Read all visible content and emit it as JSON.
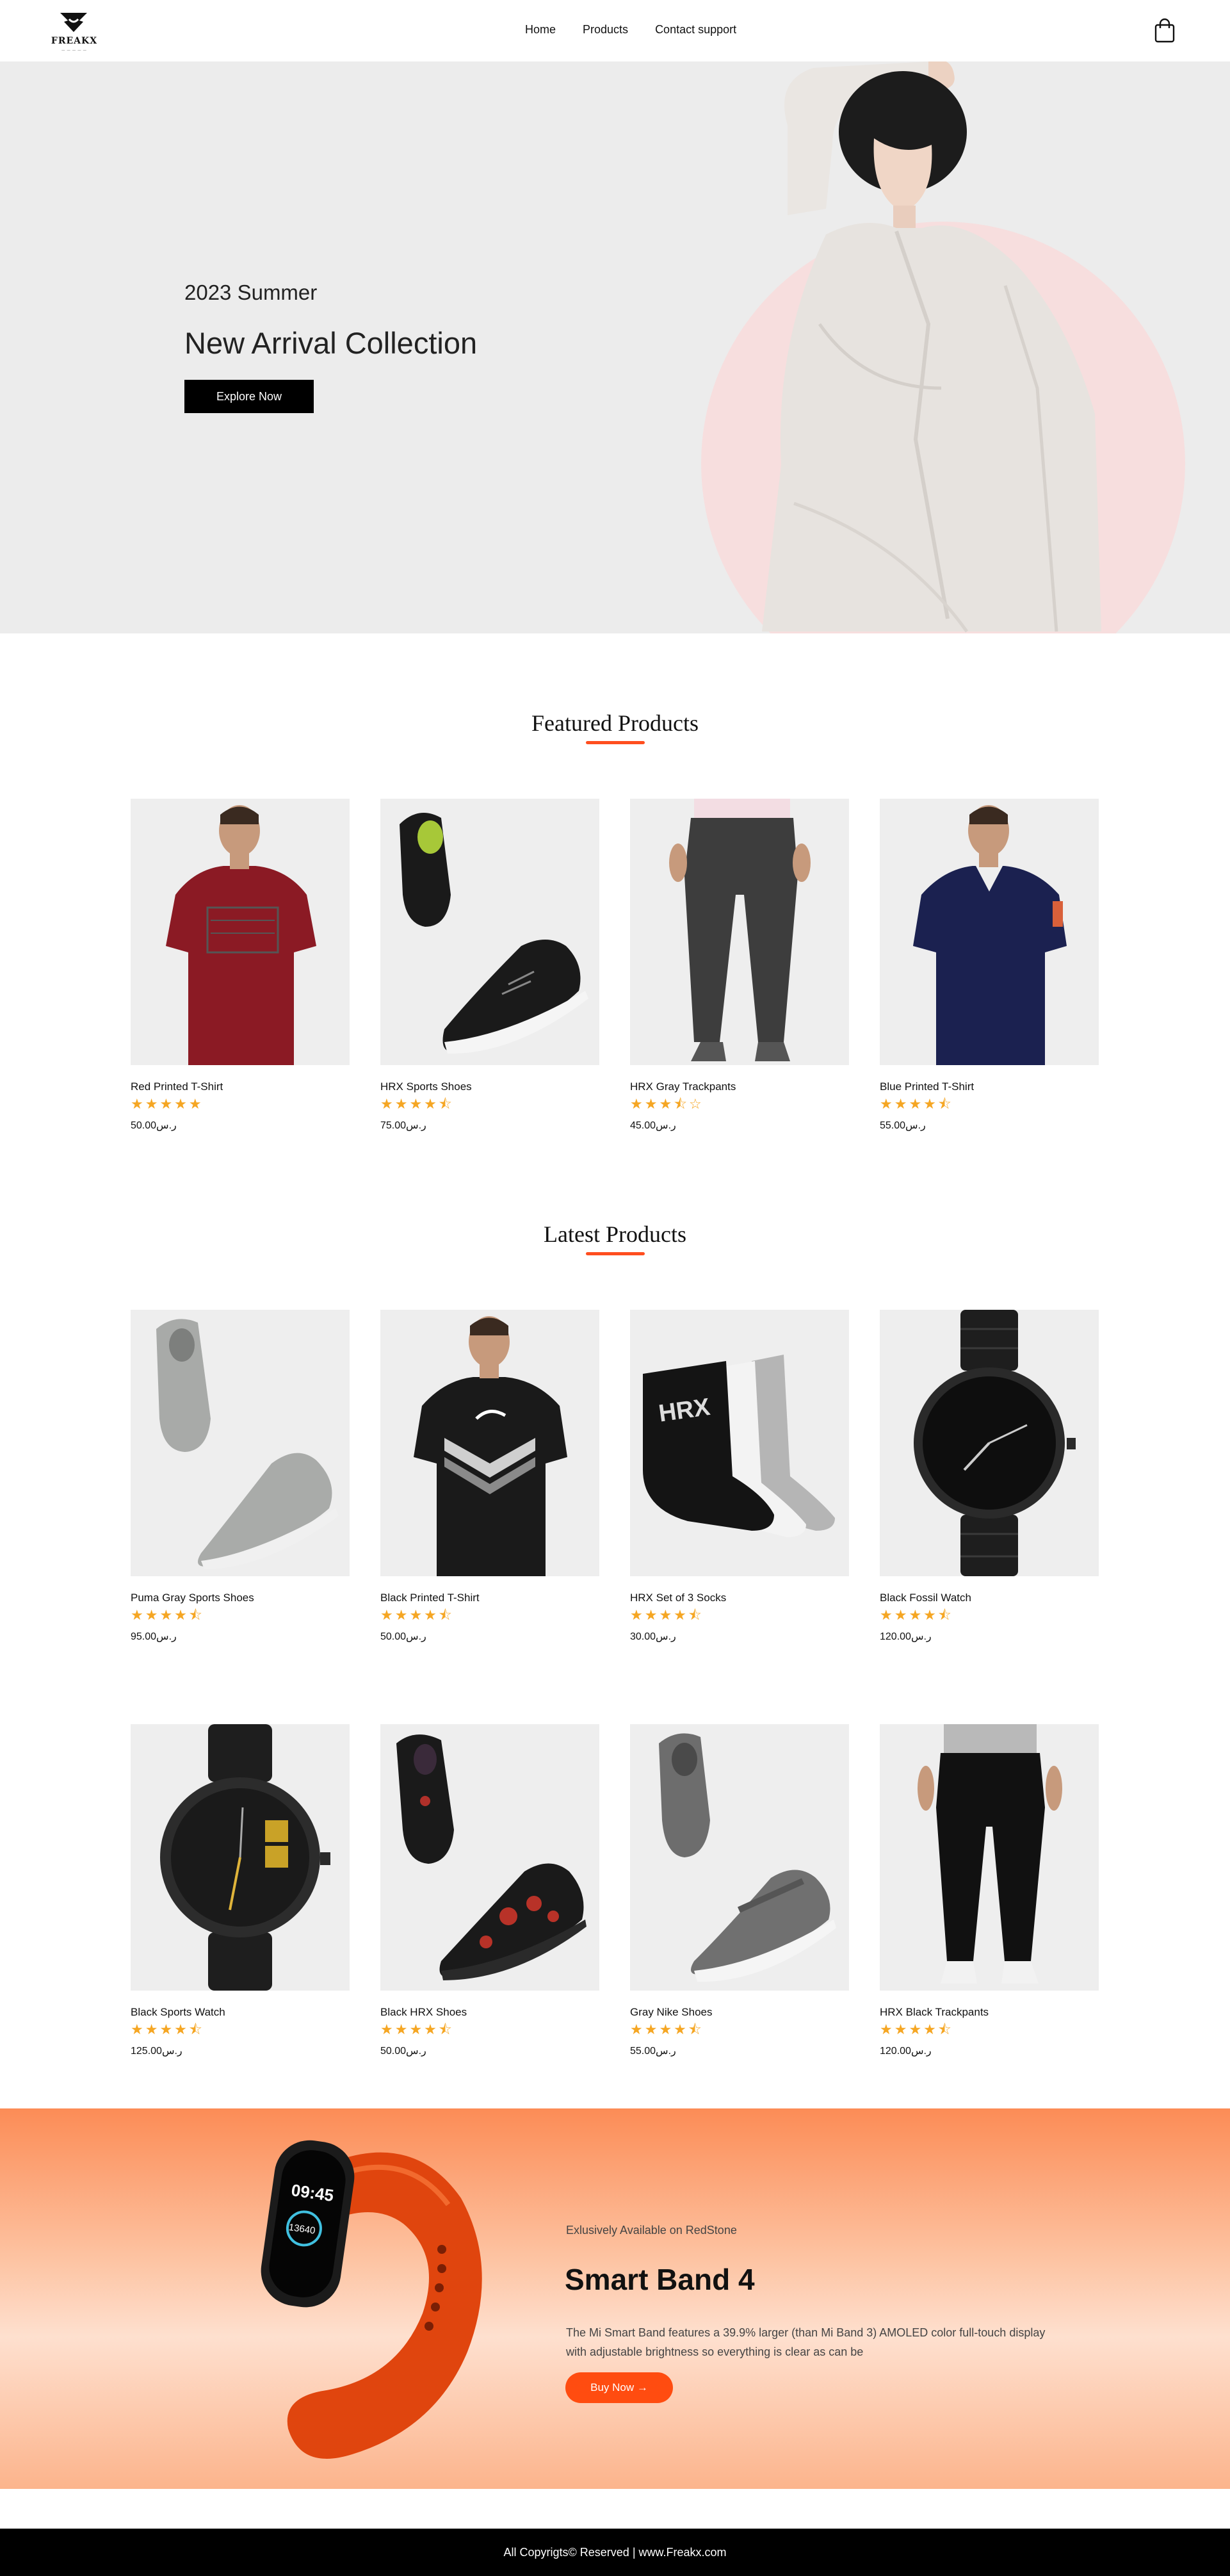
{
  "header": {
    "logo_text": "FREAKX",
    "nav": [
      "Home",
      "Products",
      "Contact support"
    ],
    "cart_icon": "shopping-bag-icon"
  },
  "hero": {
    "subtitle": "2023 Summer",
    "title": "New Arrival Collection",
    "button": "Explore Now"
  },
  "featured": {
    "title": "Featured Products",
    "products": [
      {
        "name": "Red Printed T-Shirt",
        "rating": 5,
        "stars": "★★★★★",
        "price": "50.00ر.س"
      },
      {
        "name": "HRX Sports Shoes",
        "rating": 4.5,
        "stars": "★★★★⯪",
        "price": "75.00ر.س"
      },
      {
        "name": "HRX Gray Trackpants",
        "rating": 3.5,
        "stars": "★★★⯪☆",
        "price": "45.00ر.س"
      },
      {
        "name": "Blue Printed T-Shirt",
        "rating": 4.5,
        "stars": "★★★★⯪",
        "price": "55.00ر.س"
      }
    ]
  },
  "latest": {
    "title": "Latest Products",
    "products": [
      {
        "name": "Puma Gray Sports Shoes",
        "rating": 4.5,
        "stars": "★★★★⯪",
        "price": "95.00ر.س"
      },
      {
        "name": "Black Printed T-Shirt",
        "rating": 4.5,
        "stars": "★★★★⯪",
        "price": "50.00ر.س"
      },
      {
        "name": "HRX Set of 3 Socks",
        "rating": 4.5,
        "stars": "★★★★⯪",
        "price": "30.00ر.س"
      },
      {
        "name": "Black Fossil Watch",
        "rating": 4.5,
        "stars": "★★★★⯪",
        "price": "120.00ر.س"
      },
      {
        "name": "Black Sports Watch",
        "rating": 4.5,
        "stars": "★★★★⯪",
        "price": "125.00ر.س"
      },
      {
        "name": "Black HRX Shoes",
        "rating": 4.5,
        "stars": "★★★★⯪",
        "price": "50.00ر.س"
      },
      {
        "name": "Gray Nike Shoes",
        "rating": 4.5,
        "stars": "★★★★⯪",
        "price": "55.00ر.س"
      },
      {
        "name": "HRX Black Trackpants",
        "rating": 4.5,
        "stars": "★★★★⯪",
        "price": "120.00ر.س"
      }
    ]
  },
  "promo": {
    "available": "Exlusively Available on RedStone",
    "title": "Smart Band 4",
    "description": "The Mi Smart Band features a 39.9% larger (than Mi Band 3) AMOLED color full-touch display with adjustable brightness so everything is clear as can be",
    "button": "Buy Now →",
    "band_time": "09:45",
    "band_steps": "13640"
  },
  "footer": {
    "text": "All Copyrigts© Reserved | www.Freakx.com"
  },
  "colors": {
    "accent": "#ff4e1f",
    "star": "#f5a623",
    "hero_bg": "#ececec",
    "hero_circle": "#f7dede"
  }
}
